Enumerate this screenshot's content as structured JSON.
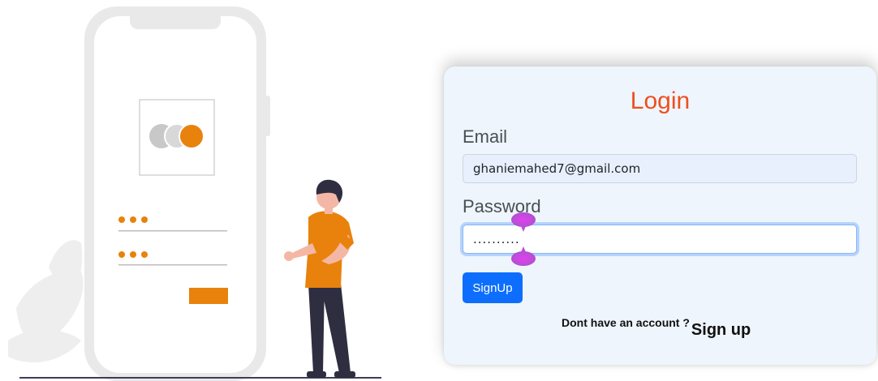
{
  "login": {
    "title": "Login",
    "email_label": "Email",
    "email_value": "ghaniemahed7@gmail.com",
    "password_label": "Password",
    "password_value": "..........",
    "submit_label": "SignUp",
    "footer_question": "Dont have an account ?",
    "footer_link": "Sign up"
  },
  "colors": {
    "title": "#f04e1f",
    "primary": "#0d6efd",
    "illustration_accent": "#e8820c",
    "card_background": "#eef5fc"
  },
  "icons": {
    "illustration": "phone-login-illustration",
    "selection_handles": "text-selection-handle-icon"
  }
}
